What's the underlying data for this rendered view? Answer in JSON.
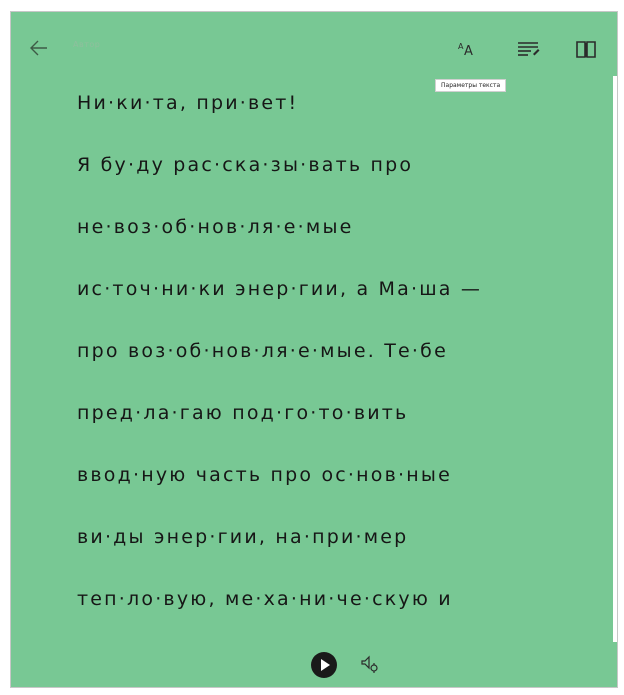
{
  "toolbar": {
    "author": "Автор",
    "back_icon": "back-arrow-icon",
    "text_size_icon": "text-size-icon",
    "grammar_icon": "grammar-tools-icon",
    "book_icon": "book-icon",
    "tooltip": "Параметры текста"
  },
  "content": {
    "lines": [
      "Ни·ки·та, при·вет!",
      "Я бу·ду рас·ска·зы·вать про",
      "не·воз·об·нов·ля·е·мые",
      "ис·точ·ни·ки энер·гии, а Ма·ша —",
      "про воз·об·нов·ля·е·мые. Те·бе",
      "пред·ла·гаю под·го·то·вить",
      "ввод·ную часть про ос·нов·ные",
      "ви·ды энер·гии, на·при·мер",
      "теп·ло·вую, ме·ха·ни·че·скую и"
    ]
  },
  "player": {
    "play_icon": "play-icon",
    "voice_icon": "voice-settings-icon"
  },
  "colors": {
    "background": "#78c894",
    "text": "#161616"
  }
}
